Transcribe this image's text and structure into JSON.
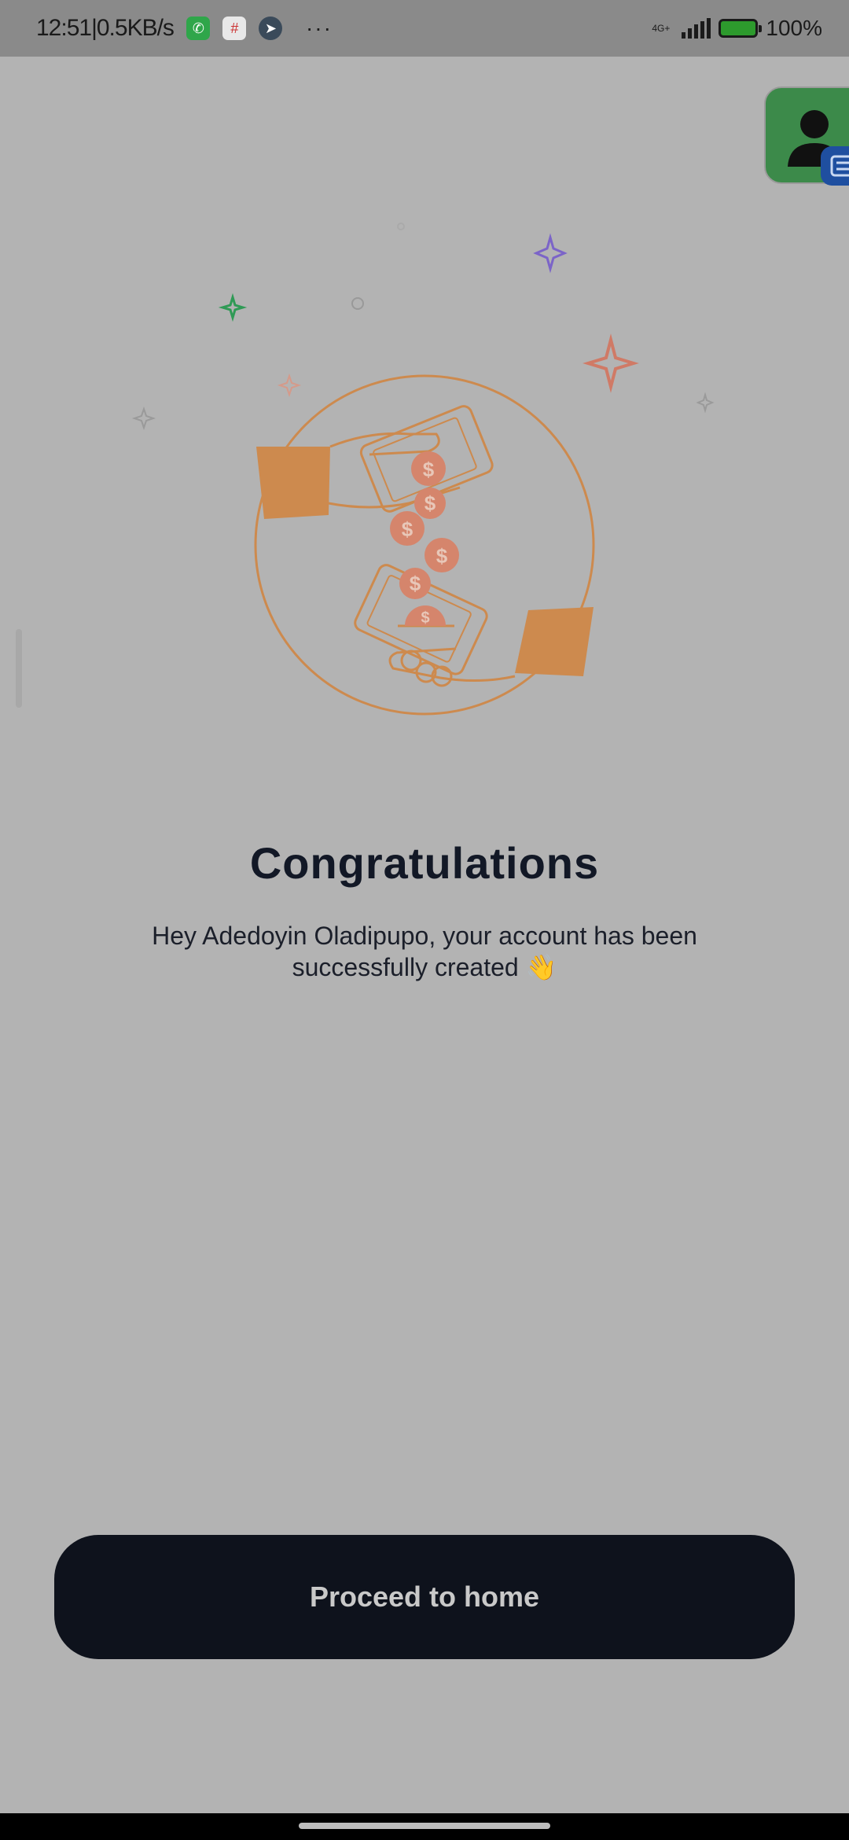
{
  "status_bar": {
    "time_speed": "12:51|0.5KB/s",
    "more_notifications": "···",
    "network_type": "4G+",
    "battery_percent": "100%",
    "notification_icons": [
      "whatsapp-icon",
      "slack-icon",
      "telegram-icon"
    ]
  },
  "floating_bubble": {
    "icon": "contacts-icon",
    "badge_icon": "message-icon"
  },
  "illustration": {
    "icon": "money-transfer-hands-icon",
    "accent_color": "#cd8a4e",
    "coin_color": "#d5856c"
  },
  "main": {
    "title": "Congratulations",
    "message": "Hey Adedoyin Oladipupo, your account has been successfully created 👋"
  },
  "actions": {
    "proceed_label": "Proceed to home"
  },
  "colors": {
    "button_bg": "#0e121c",
    "title_text": "#121826",
    "overlay_bg": "#b3b3b3"
  }
}
